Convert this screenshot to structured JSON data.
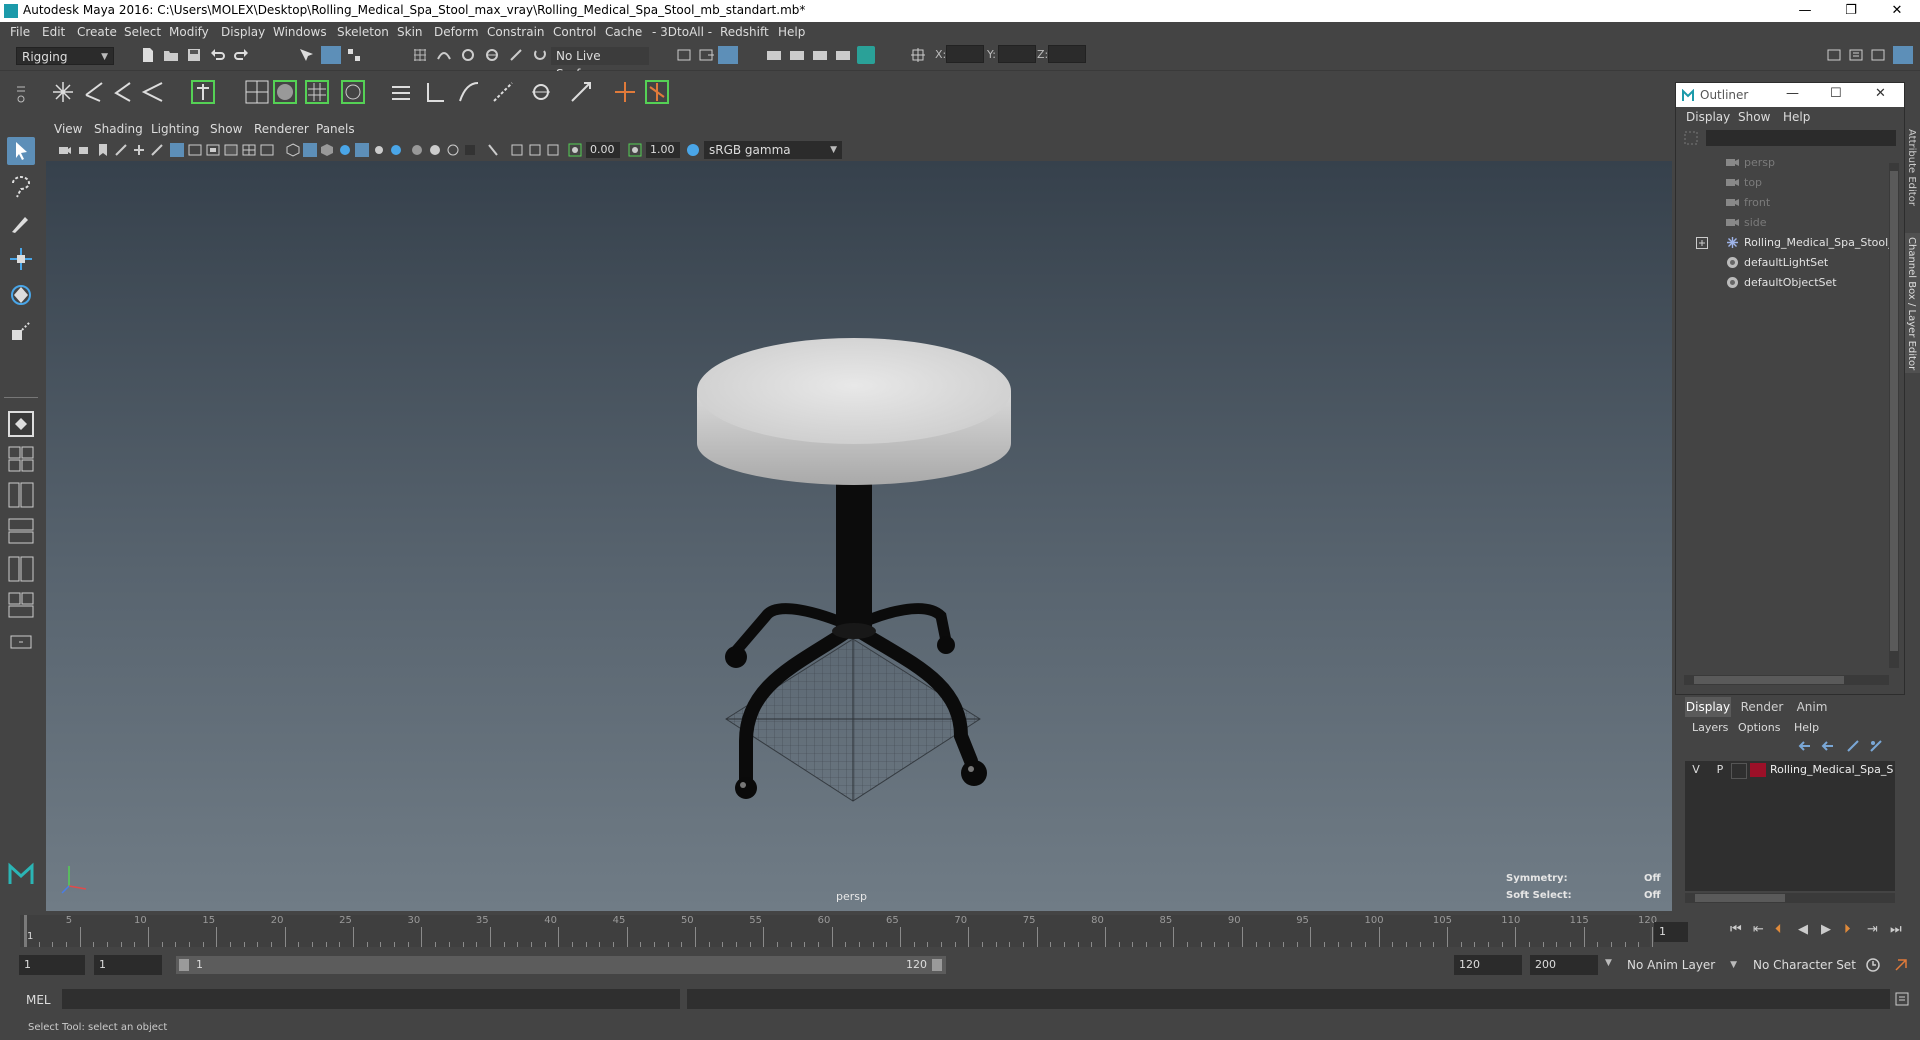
{
  "window": {
    "title": "Autodesk Maya 2016: C:\\Users\\MOLEX\\Desktop\\Rolling_Medical_Spa_Stool_max_vray\\Rolling_Medical_Spa_Stool_mb_standart.mb*",
    "minimize": "—",
    "maximize": "❐",
    "close": "✕"
  },
  "menubar": [
    "File",
    "Edit",
    "Create",
    "Select",
    "Modify",
    "Display",
    "Windows",
    "Skeleton",
    "Skin",
    "Deform",
    "Constrain",
    "Control",
    "Cache",
    "- 3DtoAll -",
    "Redshift",
    "Help"
  ],
  "statusline": {
    "menu_set": "Rigging",
    "live_surface": "No Live Surface",
    "x_label": "X:",
    "y_label": "Y:",
    "z_label": "Z:"
  },
  "viewport_panel": {
    "menus": [
      "View",
      "Shading",
      "Lighting",
      "Show",
      "Renderer",
      "Panels"
    ],
    "exposure": "0.00",
    "gamma": "1.00",
    "color_space": "sRGB gamma",
    "camera": "persp",
    "hud": {
      "symmetry_label": "Symmetry:",
      "symmetry_value": "Off",
      "soft_select_label": "Soft Select:",
      "soft_select_value": "Off"
    }
  },
  "outliner": {
    "title": "Outliner",
    "menus": [
      "Display",
      "Show",
      "Help"
    ],
    "items": [
      {
        "label": "persp",
        "dim": true,
        "icon": "camera-icon"
      },
      {
        "label": "top",
        "dim": true,
        "icon": "camera-icon"
      },
      {
        "label": "front",
        "dim": true,
        "icon": "camera-icon"
      },
      {
        "label": "side",
        "dim": true,
        "icon": "camera-icon"
      },
      {
        "label": "Rolling_Medical_Spa_Stool_",
        "dim": false,
        "icon": "group-icon",
        "expandable": true
      },
      {
        "label": "defaultLightSet",
        "dim": false,
        "icon": "set-icon"
      },
      {
        "label": "defaultObjectSet",
        "dim": false,
        "icon": "set-icon"
      }
    ]
  },
  "side_tabs": {
    "attribute_editor": "Attribute Editor",
    "channel_box": "Channel Box / Layer Editor"
  },
  "layer_editor": {
    "tabs": [
      "Display",
      "Render",
      "Anim"
    ],
    "menus": [
      "Layers",
      "Options",
      "Help"
    ],
    "layer": {
      "v": "V",
      "p": "P",
      "color": "#9b1028",
      "name": "Rolling_Medical_Spa_S"
    }
  },
  "timeline": {
    "labels": [
      "1",
      "5",
      "10",
      "15",
      "20",
      "25",
      "30",
      "35",
      "40",
      "45",
      "50",
      "55",
      "60",
      "65",
      "70",
      "75",
      "80",
      "85",
      "90",
      "95",
      "100",
      "105",
      "110",
      "115",
      "120"
    ],
    "current_frame": "1"
  },
  "range": {
    "start": "1",
    "playback_start": "1",
    "slider_start": "1",
    "slider_end": "120",
    "playback_end": "120",
    "end": "200",
    "anim_layer": "No Anim Layer",
    "character_set": "No Character Set"
  },
  "command": {
    "language": "MEL",
    "help_text": "Select Tool: select an object"
  }
}
